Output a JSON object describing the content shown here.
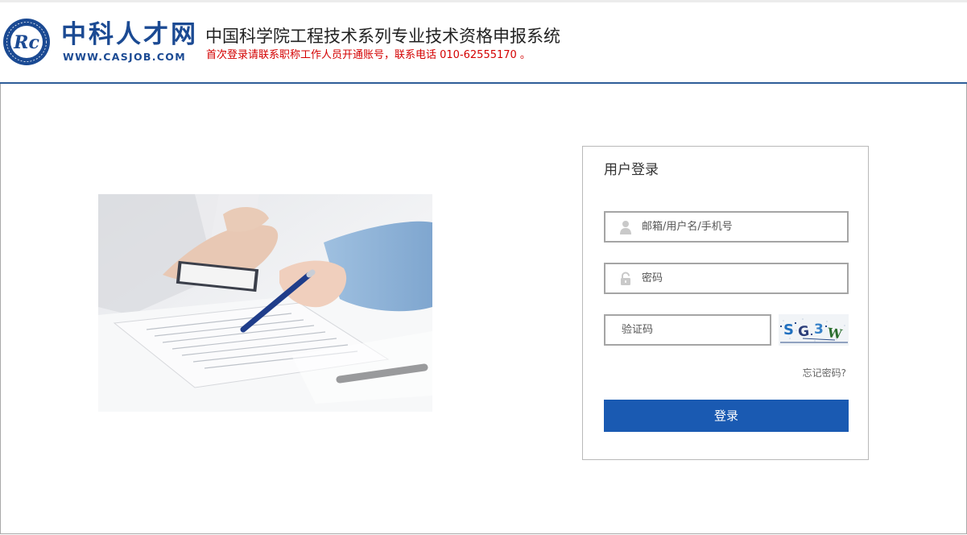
{
  "header": {
    "logo_cn": "中科人才网",
    "logo_url": "WWW.CASJOB.COM",
    "system_title": "中国科学院工程技术系列专业技术资格申报系统",
    "notice": "首次登录请联系职称工作人员开通账号，联系电话 010-62555170 。"
  },
  "login": {
    "title": "用户登录",
    "username_placeholder": "邮箱/用户名/手机号",
    "password_placeholder": "密码",
    "captcha_placeholder": "验证码",
    "captcha_text": "SG3W",
    "forgot_label": "忘记密码?",
    "submit_label": "登录"
  },
  "colors": {
    "brand_blue": "#1b4a93",
    "button_blue": "#1a5ab2",
    "notice_red": "#d40000",
    "header_rule": "#2e5d98"
  },
  "icons": {
    "user_field": "user-icon",
    "password_field": "lock-icon"
  }
}
